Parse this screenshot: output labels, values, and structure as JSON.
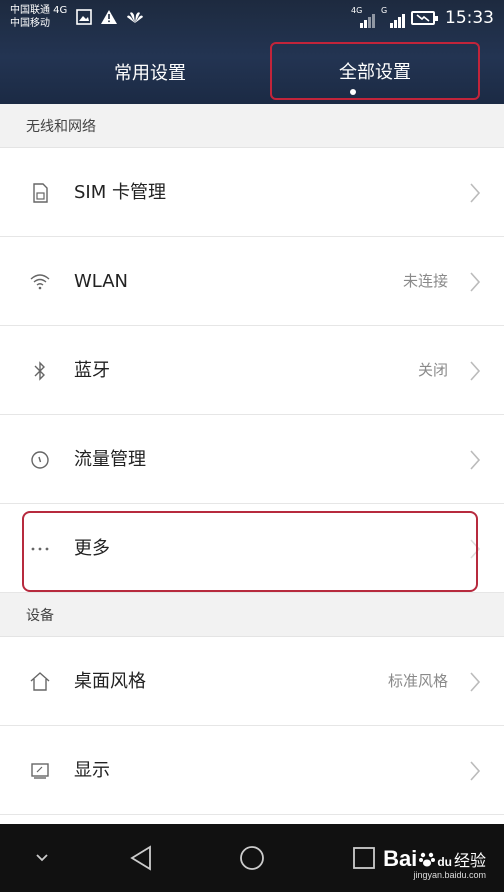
{
  "status_bar": {
    "carrier_1": "中国联通 4G",
    "carrier_2": "中国移动",
    "net_1": "4G",
    "net_2": "G",
    "time": "15:33"
  },
  "tabs": [
    {
      "label": "常用设置"
    },
    {
      "label": "全部设置",
      "selected": true
    }
  ],
  "sections": [
    {
      "title": "无线和网络",
      "items": [
        {
          "label": "SIM 卡管理",
          "value": "",
          "icon": "sim-card-icon"
        },
        {
          "label": "WLAN",
          "value": "未连接",
          "icon": "wifi-icon"
        },
        {
          "label": "蓝牙",
          "value": "关闭",
          "icon": "bluetooth-icon"
        },
        {
          "label": "流量管理",
          "value": "",
          "icon": "data-usage-icon"
        },
        {
          "label": "更多",
          "value": "",
          "icon": "more-dots-icon"
        }
      ]
    },
    {
      "title": "设备",
      "items": [
        {
          "label": "桌面风格",
          "value": "标准风格",
          "icon": "home-icon"
        },
        {
          "label": "显示",
          "value": "",
          "icon": "display-icon"
        }
      ]
    }
  ],
  "watermark": {
    "brand": "Bai",
    "brand_paw": "du",
    "jingyan": "经验",
    "url": "jingyan.baidu.com"
  },
  "colors": {
    "header_bg": "#1d2a3f",
    "highlight_red": "#c2243a",
    "section_bg": "#f2f2f2",
    "navbar_bg": "#111111"
  }
}
